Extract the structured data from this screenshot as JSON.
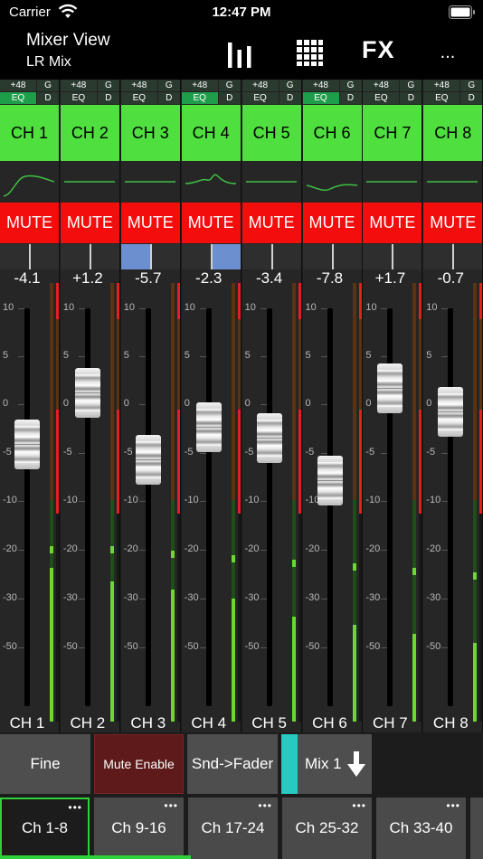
{
  "status": {
    "carrier": "Carrier",
    "time": "12:47 PM"
  },
  "toolbar": {
    "title": "Mixer View",
    "subtitle": "LR Mix",
    "fx_label": "FX",
    "more_label": "..."
  },
  "scale_labels": [
    "10",
    "5",
    "0",
    "-5",
    "-10",
    "-20",
    "-30",
    "-50"
  ],
  "channels": [
    {
      "name": "CH 1",
      "footer": "CH 1",
      "mute": "MUTE",
      "gain": "-4.1",
      "p48": "+48",
      "g": "G",
      "eq": "EQ",
      "d": "D",
      "eq_on": true,
      "p48_on": false,
      "pan": 0,
      "fader_db": -4.1,
      "meter_level": 0.35,
      "peak": 0.4
    },
    {
      "name": "CH 2",
      "footer": "CH 2",
      "mute": "MUTE",
      "gain": "+1.2",
      "p48": "+48",
      "g": "G",
      "eq": "EQ",
      "d": "D",
      "eq_on": false,
      "p48_on": false,
      "pan": 0,
      "fader_db": 1.2,
      "meter_level": 0.32,
      "peak": 0.4
    },
    {
      "name": "CH 3",
      "footer": "CH 3",
      "mute": "MUTE",
      "gain": "-5.7",
      "p48": "+48",
      "g": "G",
      "eq": "EQ",
      "d": "D",
      "eq_on": false,
      "p48_on": false,
      "pan": -0.5,
      "fader_db": -5.7,
      "meter_level": 0.3,
      "peak": 0.39
    },
    {
      "name": "CH 4",
      "footer": "CH 4",
      "mute": "MUTE",
      "gain": "-2.3",
      "p48": "+48",
      "g": "G",
      "eq": "EQ",
      "d": "D",
      "eq_on": true,
      "p48_on": false,
      "pan": 0.5,
      "fader_db": -2.3,
      "meter_level": 0.28,
      "peak": 0.38
    },
    {
      "name": "CH 5",
      "footer": "CH 5",
      "mute": "MUTE",
      "gain": "-3.4",
      "p48": "+48",
      "g": "G",
      "eq": "EQ",
      "d": "D",
      "eq_on": false,
      "p48_on": false,
      "pan": 0,
      "fader_db": -3.4,
      "meter_level": 0.24,
      "peak": 0.37
    },
    {
      "name": "CH 6",
      "footer": "CH 6",
      "mute": "MUTE",
      "gain": "-7.8",
      "p48": "+48",
      "g": "G",
      "eq": "EQ",
      "d": "D",
      "eq_on": true,
      "p48_on": false,
      "pan": 0,
      "fader_db": -7.8,
      "meter_level": 0.22,
      "peak": 0.36
    },
    {
      "name": "CH 7",
      "footer": "CH 7",
      "mute": "MUTE",
      "gain": "+1.7",
      "p48": "+48",
      "g": "G",
      "eq": "EQ",
      "d": "D",
      "eq_on": false,
      "p48_on": false,
      "pan": 0,
      "fader_db": 1.7,
      "meter_level": 0.2,
      "peak": 0.35
    },
    {
      "name": "CH 8",
      "footer": "CH 8",
      "mute": "MUTE",
      "gain": "-0.7",
      "p48": "+48",
      "g": "G",
      "eq": "EQ",
      "d": "D",
      "eq_on": false,
      "p48_on": false,
      "pan": 0,
      "fader_db": -0.7,
      "meter_level": 0.18,
      "peak": 0.34
    }
  ],
  "controls": {
    "fine": "Fine",
    "mute_enable": "Mute Enable",
    "snd_fader": "Snd->Fader",
    "mix": "Mix 1"
  },
  "banks": [
    {
      "label": "Ch 1-8",
      "dots": "•••",
      "selected": true
    },
    {
      "label": "Ch 9-16",
      "dots": "•••",
      "selected": false
    },
    {
      "label": "Ch 17-24",
      "dots": "•••",
      "selected": false
    },
    {
      "label": "Ch 25-32",
      "dots": "•••",
      "selected": false
    },
    {
      "label": "Ch 33-40",
      "dots": "•••",
      "selected": false
    }
  ],
  "colors": {
    "channel_green": "#4fe03f",
    "mute_red": "#f30d0d",
    "meter_green": "#6bd932",
    "pan_blue": "#6c8fd0",
    "selection": "#2fd13a"
  }
}
